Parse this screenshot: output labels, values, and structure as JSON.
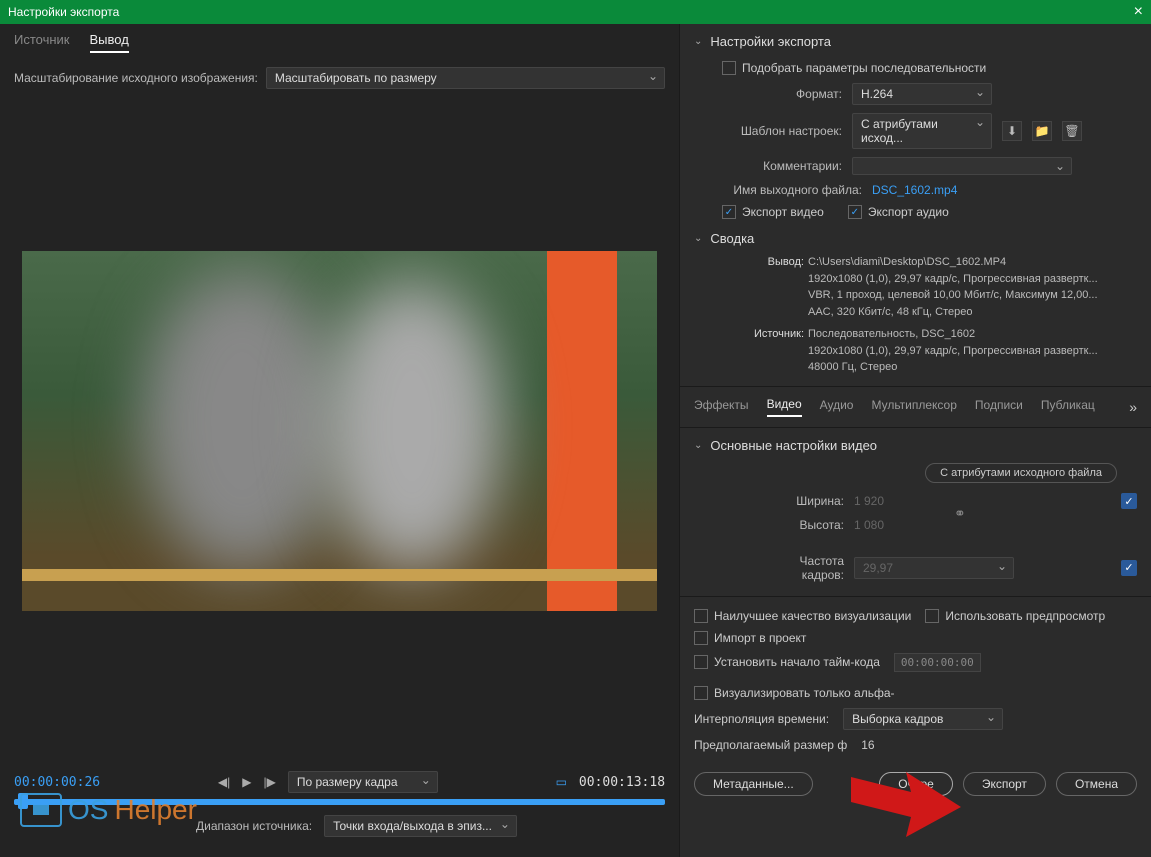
{
  "title": "Настройки экспорта",
  "leftTabs": {
    "source": "Источник",
    "output": "Вывод"
  },
  "scaling": {
    "label": "Масштабирование исходного изображения:",
    "value": "Масштабировать по размеру"
  },
  "timecodes": {
    "current": "00:00:00:26",
    "total": "00:00:13:18"
  },
  "fit": {
    "value": "По размеру кадра"
  },
  "range": {
    "label": "Диапазон источника:",
    "value": "Точки входа/выхода в эпиз..."
  },
  "export": {
    "header": "Настройки экспорта",
    "matchSeq": "Подобрать параметры последовательности",
    "formatLabel": "Формат:",
    "formatValue": "H.264",
    "presetLabel": "Шаблон настроек:",
    "presetValue": "С атрибутами исход...",
    "commentsLabel": "Комментарии:",
    "outputNameLabel": "Имя выходного файла:",
    "outputNameValue": "DSC_1602.mp4",
    "exportVideo": "Экспорт видео",
    "exportAudio": "Экспорт аудио"
  },
  "summary": {
    "header": "Сводка",
    "outKey": "Вывод:",
    "outLines": [
      "C:\\Users\\diami\\Desktop\\DSC_1602.MP4",
      "1920x1080 (1,0), 29,97 кадр/с, Прогрессивная развертк...",
      "VBR, 1 проход, целевой 10,00 Мбит/с, Максимум 12,00...",
      "AAC, 320 Кбит/с, 48 кГц, Стерео"
    ],
    "srcKey": "Источник:",
    "srcLines": [
      "Последовательность, DSC_1602",
      "1920x1080 (1,0), 29,97 кадр/с, Прогрессивная развертк...",
      "48000 Гц, Стерео"
    ]
  },
  "midTabs": {
    "effects": "Эффекты",
    "video": "Видео",
    "audio": "Аудио",
    "mux": "Мультиплексор",
    "captions": "Подписи",
    "publish": "Публикац"
  },
  "videoSettings": {
    "header": "Основные настройки видео",
    "pill": "С атрибутами исходного файла",
    "widthLabel": "Ширина:",
    "widthVal": "1 920",
    "heightLabel": "Высота:",
    "heightVal": "1 080",
    "fpsLabel": "Частота кадров:",
    "fpsVal": "29,97"
  },
  "footer": {
    "bestQuality": "Наилучшее качество визуализации",
    "usePreview": "Использовать предпросмотр",
    "importProject": "Импорт в проект",
    "setTimecode": "Установить начало тайм-кода",
    "timecodeBox": "00:00:00:00",
    "alphaOnly": "Визуализировать только альфа-",
    "interpLabel": "Интерполяция времени:",
    "interpVal": "Выборка кадров",
    "estSizeLabel": "Предполагаемый размер ф",
    "estSizeVal": "16"
  },
  "buttons": {
    "metadata": "Метаданные...",
    "queue": "Очере",
    "export": "Экспорт",
    "cancel": "Отмена"
  },
  "watermark": {
    "t1": "OS",
    "t2": "Helper"
  }
}
